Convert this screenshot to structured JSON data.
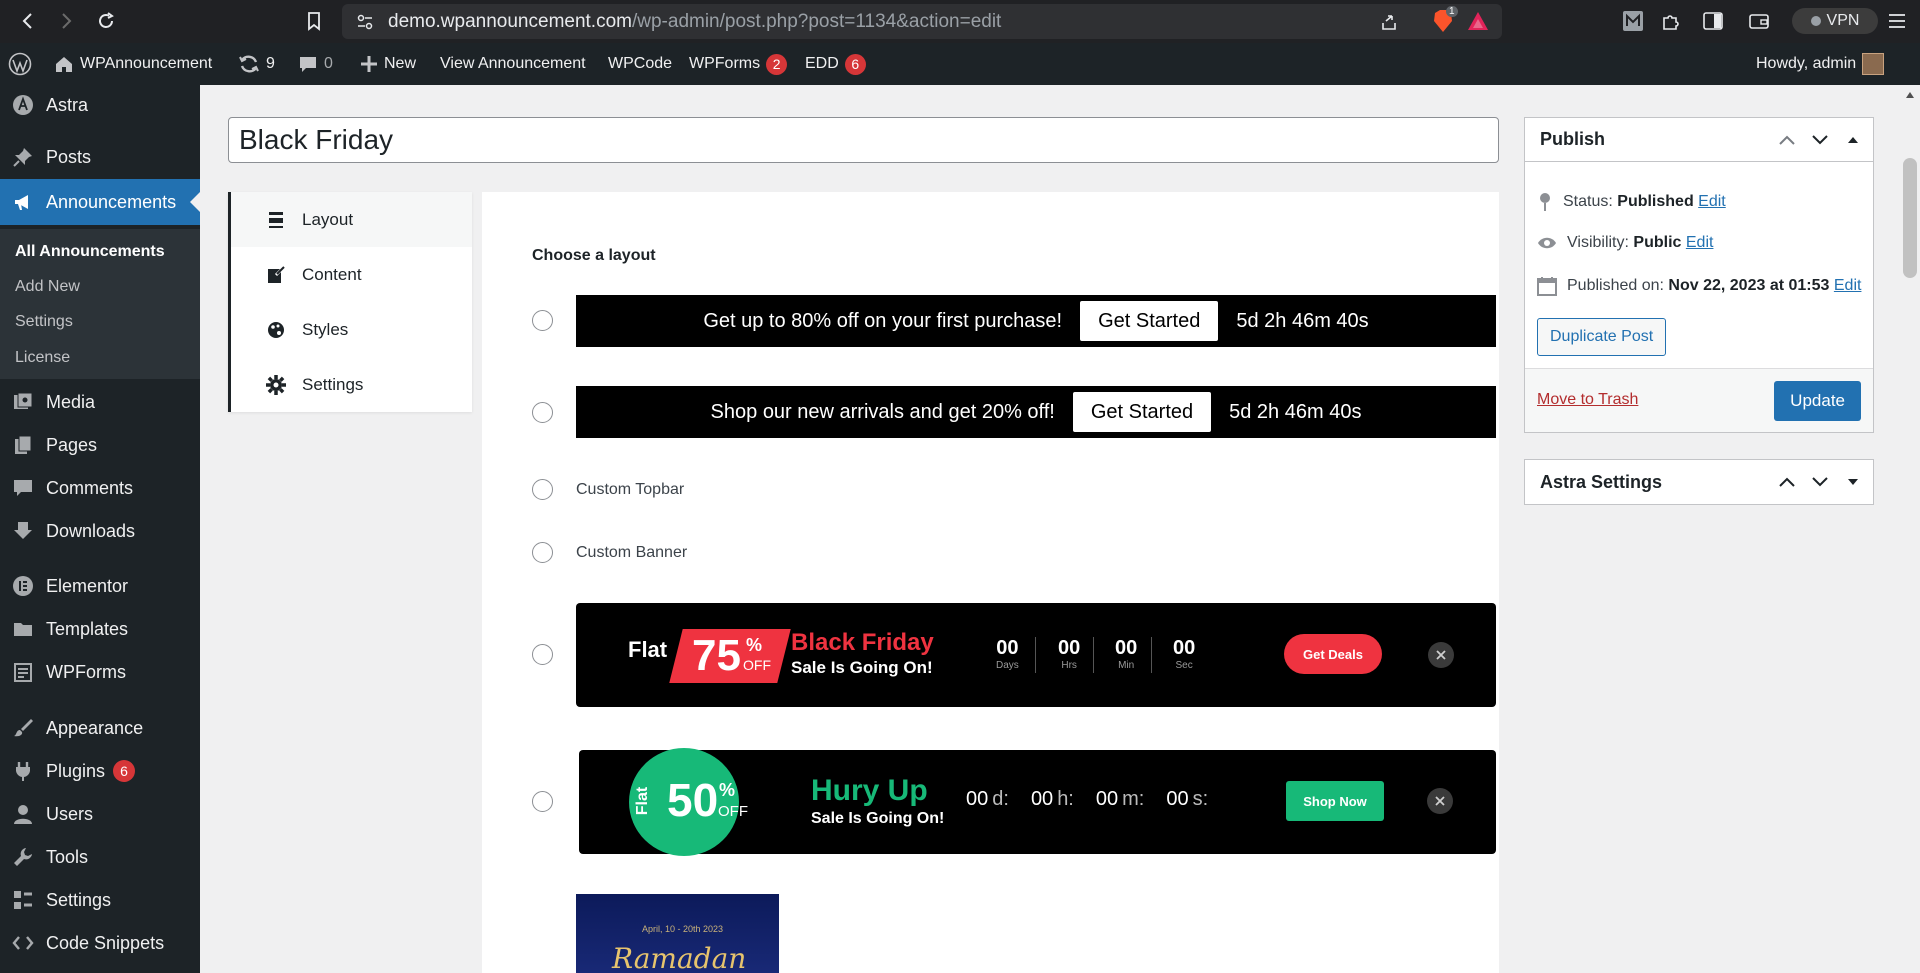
{
  "browser": {
    "url_host": "demo.wpannouncement.com",
    "url_path": "/wp-admin/post.php?post=1134&action=edit",
    "brave_badge": "1",
    "vpn_label": "VPN"
  },
  "adminbar": {
    "site_name": "WPAnnouncement",
    "updates_count": "9",
    "comments_count": "0",
    "new_label": "New",
    "view_label": "View Announcement",
    "wpcode_label": "WPCode",
    "wpforms_label": "WPForms",
    "wpforms_count": "2",
    "edd_label": "EDD",
    "edd_count": "6",
    "howdy": "Howdy, admin"
  },
  "sidebar": {
    "astra": "Astra",
    "posts": "Posts",
    "announcements": "Announcements",
    "sub": [
      "All Announcements",
      "Add New",
      "Settings",
      "License"
    ],
    "media": "Media",
    "pages": "Pages",
    "comments": "Comments",
    "downloads": "Downloads",
    "elementor": "Elementor",
    "templates": "Templates",
    "wpforms": "WPForms",
    "appearance": "Appearance",
    "plugins": "Plugins",
    "plugins_count": "6",
    "users": "Users",
    "tools": "Tools",
    "settings": "Settings",
    "code_snippets": "Code Snippets"
  },
  "editor": {
    "title_value": "Black Friday"
  },
  "tabs": [
    "Layout",
    "Content",
    "Styles",
    "Settings"
  ],
  "layout": {
    "heading": "Choose a layout",
    "banner1_text": "Get up to 80% off on your first purchase!",
    "banner1_btn": "Get Started",
    "banner1_timer": "5d 2h 46m 40s",
    "banner2_text": "Shop our new arrivals and get 20% off!",
    "banner2_btn": "Get Started",
    "banner2_timer": "5d 2h 46m 40s",
    "custom_topbar": "Custom Topbar",
    "custom_banner": "Custom Banner",
    "bf": {
      "flat": "Flat",
      "pct": "75",
      "pct_sym": "%",
      "off": "OFF",
      "title": "Black Friday",
      "subtitle": "Sale Is Going On!",
      "countdown": [
        {
          "num": "00",
          "lbl": "Days"
        },
        {
          "num": "00",
          "lbl": "Hrs"
        },
        {
          "num": "00",
          "lbl": "Min"
        },
        {
          "num": "00",
          "lbl": "Sec"
        }
      ],
      "cta": "Get Deals",
      "accent": "#ef3340"
    },
    "hu": {
      "flat": "Flat",
      "pct": "50",
      "pct_sym": "%",
      "off": "OFF",
      "title": "Hury Up",
      "subtitle": "Sale Is Going On!",
      "d": "00",
      "d_lbl": "d:",
      "h": "00",
      "h_lbl": "h:",
      "m": "00",
      "m_lbl": "m:",
      "s": "00",
      "s_lbl": "s:",
      "cta": "Shop Now",
      "accent": "#17b978"
    },
    "thumb_date": "April, 10 - 20th 2023",
    "thumb_title": "Ramadan"
  },
  "publish": {
    "title": "Publish",
    "status_label": "Status:",
    "status_value": "Published",
    "visibility_label": "Visibility:",
    "visibility_value": "Public",
    "published_label": "Published on:",
    "published_value": "Nov 22, 2023 at 01:53",
    "edit": "Edit",
    "duplicate": "Duplicate Post",
    "trash": "Move to Trash",
    "update": "Update"
  },
  "astra_settings": {
    "title": "Astra Settings"
  }
}
